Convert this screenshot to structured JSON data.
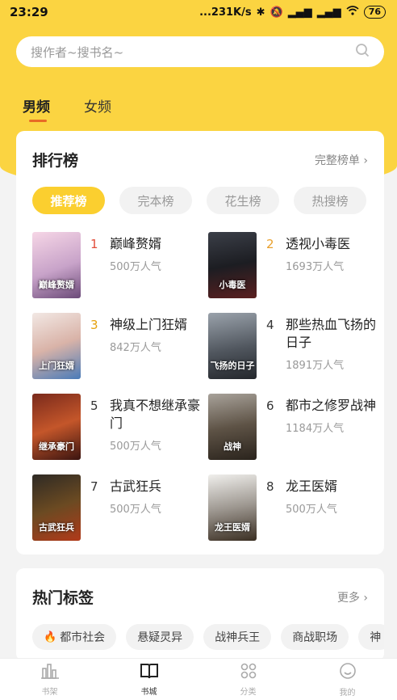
{
  "status": {
    "time": "23:29",
    "network": "...231K/s",
    "battery": "76"
  },
  "search": {
    "placeholder": "搜作者~搜书名~"
  },
  "gender_tabs": [
    {
      "label": "男频",
      "active": true
    },
    {
      "label": "女频",
      "active": false
    }
  ],
  "ranking": {
    "title": "排行榜",
    "more": "完整榜单 ›",
    "tabs": [
      "推荐榜",
      "完本榜",
      "花生榜",
      "热搜榜"
    ],
    "books": [
      {
        "rank": "1",
        "title": "巅峰赘婿",
        "popularity": "500万人气",
        "cover_text": "巅峰赘婿"
      },
      {
        "rank": "2",
        "title": "透视小毒医",
        "popularity": "1693万人气",
        "cover_text": "小毒医"
      },
      {
        "rank": "3",
        "title": "神级上门狂婿",
        "popularity": "842万人气",
        "cover_text": "上门狂婿"
      },
      {
        "rank": "4",
        "title": "那些热血飞扬的日子",
        "popularity": "1891万人气",
        "cover_text": "飞扬的日子"
      },
      {
        "rank": "5",
        "title": "我真不想继承豪门",
        "popularity": "500万人气",
        "cover_text": "继承豪门"
      },
      {
        "rank": "6",
        "title": "都市之修罗战神",
        "popularity": "1184万人气",
        "cover_text": "战神"
      },
      {
        "rank": "7",
        "title": "古武狂兵",
        "popularity": "500万人气",
        "cover_text": "古武狂兵"
      },
      {
        "rank": "8",
        "title": "龙王医婿",
        "popularity": "500万人气",
        "cover_text": "龙王医婿"
      }
    ]
  },
  "tags": {
    "title": "热门标签",
    "more": "更多 ›",
    "items": [
      "都市社会",
      "悬疑灵异",
      "战神兵王",
      "商战职场",
      "神"
    ]
  },
  "tabbar": [
    {
      "label": "书架",
      "icon": "bookshelf-icon",
      "active": false
    },
    {
      "label": "书城",
      "icon": "book-icon",
      "active": true
    },
    {
      "label": "分类",
      "icon": "grid-icon",
      "active": false
    },
    {
      "label": "我的",
      "icon": "smiley-icon",
      "active": false
    }
  ]
}
